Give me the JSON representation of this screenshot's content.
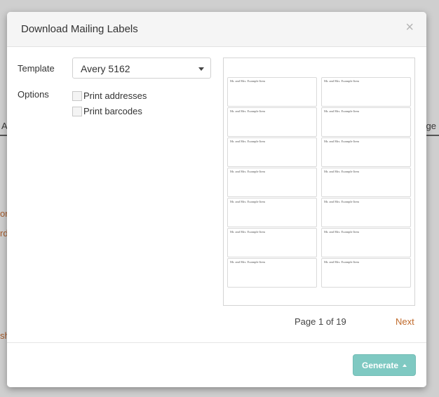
{
  "background": {
    "fragments": [
      "A",
      "erge",
      "or",
      "rd",
      "sh"
    ]
  },
  "modal": {
    "title": "Download Mailing Labels",
    "close_glyph": "×",
    "template_label": "Template",
    "template_value": "Avery 5162",
    "options_label": "Options",
    "options": [
      {
        "label": "Print addresses",
        "checked": false
      },
      {
        "label": "Print barcodes",
        "checked": false
      }
    ],
    "preview": {
      "labels": [
        "Mr. and Mrs. Example Item",
        "Mr. and Mrs. Example Item",
        "Mr. and Mrs. Example Item",
        "Mr. and Mrs. Example Item",
        "Mr. and Mrs. Example Item",
        "Mr. and Mrs. Example Item",
        "Mr. and Mrs. Example Item",
        "Mr. and Mrs. Example Item",
        "Mr. and Mrs. Example Item",
        "Mr. and Mrs. Example Item",
        "Mr. and Mrs. Example Item",
        "Mr. and Mrs. Example Item",
        "Mr. and Mrs. Example Item",
        "Mr. and Mrs. Example Item"
      ]
    },
    "pager": {
      "text": "Page 1 of 19",
      "next_label": "Next"
    },
    "generate_label": "Generate",
    "colors": {
      "accent": "#7fc9c2",
      "link": "#c06a2b"
    }
  }
}
